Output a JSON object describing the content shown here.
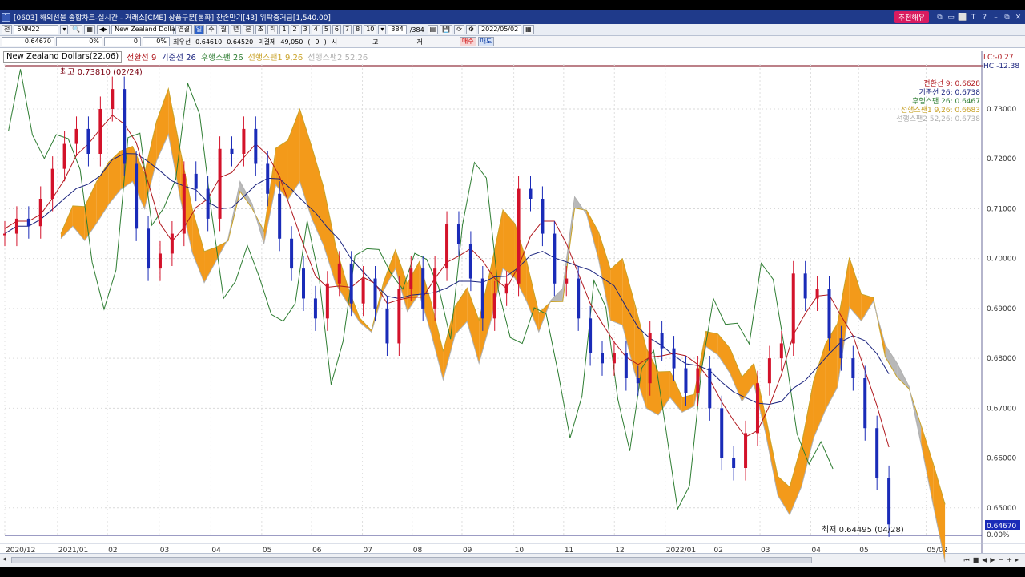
{
  "window": {
    "title": "[0603] 해외선물 종합차트-실시간 - 거래소[CME] 상품구분[통화] 잔존만기[43] 위탁증거금[1,540.00]",
    "recommend_label": "추천해유",
    "controls": [
      "⧉",
      "▭",
      "⬜",
      "T",
      "?",
      "–",
      "⧉",
      "✕"
    ]
  },
  "toolbar1": {
    "type_label": "전",
    "symbol": "6NM22",
    "product_name": "New Zealand Dollars",
    "link_label": "연결",
    "periods": [
      "일",
      "주",
      "월",
      "년",
      "분",
      "초",
      "틱"
    ],
    "active_period": "일",
    "intervals": [
      "1",
      "2",
      "3",
      "4",
      "5",
      "6",
      "7",
      "8",
      "10"
    ],
    "bar_count": "384",
    "bar_total": "/384",
    "date": "2022/05/02"
  },
  "toolbar2": {
    "price": "0.64670",
    "change_pct": "0%",
    "volume": "0",
    "volume_pct": "0%",
    "best_ask_label": "최우선",
    "best_ask": "0.64610",
    "best_bid": "0.64520",
    "open_interest_label": "미결제",
    "open_interest": "49,050",
    "oi_paren": "(",
    "oi_count": "9",
    "oi_paren_close": ")",
    "time_label": "시",
    "high_label": "고",
    "low_label": "저",
    "buy_label": "매수",
    "sell_label": "매도"
  },
  "legend": {
    "symbol": "New Zealand Dollars(22.06)",
    "items": [
      {
        "name": "전환선",
        "param": "9",
        "color": "#b0181e"
      },
      {
        "name": "기준선",
        "param": "26",
        "color": "#1a237e"
      },
      {
        "name": "후행스팬",
        "param": "26",
        "color": "#2e7d32"
      },
      {
        "name": "선행스팬1",
        "param": "9,26",
        "color": "#c9a227"
      },
      {
        "name": "선행스팬2",
        "param": "52,26",
        "color": "#b0b0b0"
      }
    ]
  },
  "annotations": {
    "high": "최고 0.73810 (02/24)",
    "low": "최저 0.64495 (04/28)",
    "lc": "LC:-0.27",
    "hc": "HC:-12.38"
  },
  "indicator_values": [
    {
      "label": "전환선 9: 0.6628",
      "color": "#b0181e"
    },
    {
      "label": "기준선 26: 0.6738",
      "color": "#1a237e"
    },
    {
      "label": "후행스팬 26: 0.6467",
      "color": "#2e7d32"
    },
    {
      "label": "선행스팬1 9,26: 0.6683",
      "color": "#c9a227"
    },
    {
      "label": "선행스팬2 52,26: 0.6738",
      "color": "#b0b0b0"
    }
  ],
  "current_price_tag": "0.64670",
  "zero_pct": "0.00%",
  "chart_data": {
    "type": "candlestick",
    "title": "New Zealand Dollars(22.06)",
    "y_ticks": [
      "0.73000",
      "0.72000",
      "0.71000",
      "0.70000",
      "0.69000",
      "0.68000",
      "0.67000",
      "0.66000",
      "0.65000"
    ],
    "ylim": [
      0.6445,
      0.739
    ],
    "x_ticks": [
      "2020/12",
      "2021/01",
      "02",
      "03",
      "04",
      "05",
      "06",
      "07",
      "08",
      "09",
      "10",
      "11",
      "12",
      "2022/01",
      "02",
      "03",
      "04",
      "05",
      "05/02"
    ],
    "x_tick_pos": [
      0,
      5.4,
      10.5,
      15.8,
      21.1,
      26.3,
      31.4,
      36.6,
      41.7,
      46.8,
      52.1,
      57.2,
      62.4,
      67.6,
      72.5,
      77.3,
      82.5,
      87.4,
      94.3
    ],
    "close_series": [
      0.705,
      0.708,
      0.7065,
      0.712,
      0.718,
      0.723,
      0.726,
      0.721,
      0.73,
      0.734,
      0.719,
      0.706,
      0.698,
      0.701,
      0.705,
      0.717,
      0.714,
      0.708,
      0.722,
      0.721,
      0.726,
      0.719,
      0.713,
      0.704,
      0.698,
      0.692,
      0.688,
      0.695,
      0.699,
      0.691,
      0.696,
      0.69,
      0.683,
      0.694,
      0.698,
      0.69,
      0.698,
      0.707,
      0.703,
      0.696,
      0.688,
      0.693,
      0.695,
      0.714,
      0.712,
      0.705,
      0.695,
      0.696,
      0.688,
      0.681,
      0.679,
      0.681,
      0.676,
      0.675,
      0.685,
      0.682,
      0.678,
      0.673,
      0.678,
      0.67,
      0.66,
      0.658,
      0.665,
      0.675,
      0.68,
      0.683,
      0.697,
      0.692,
      0.694,
      0.684,
      0.68,
      0.676,
      0.666,
      0.656,
      0.6467
    ]
  }
}
